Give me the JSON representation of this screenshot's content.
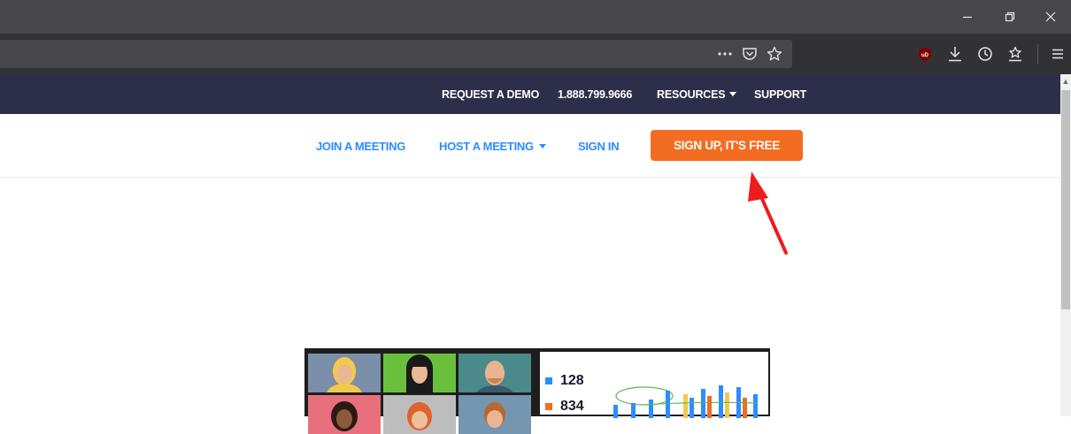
{
  "browser": {
    "window_controls": {
      "minimize": "minimize-icon",
      "restore": "restore-icon",
      "close": "close-icon"
    },
    "page_actions": [
      "more-icon",
      "pocket-icon",
      "bookmark-star-icon"
    ],
    "toolbar_icons": [
      "ublock-icon",
      "downloads-icon",
      "history-icon",
      "library-icon",
      "menu-icon"
    ],
    "ublock_label": "uD"
  },
  "site": {
    "topbar": {
      "items": [
        {
          "label": "REQUEST A DEMO"
        },
        {
          "label": "1.888.799.9666"
        },
        {
          "label": "RESOURCES"
        },
        {
          "label": "SUPPORT"
        }
      ]
    },
    "mainnav": {
      "join": "JOIN A MEETING",
      "host": "HOST A MEETING",
      "signin": "SIGN IN",
      "signup": "SIGN UP, IT'S FREE"
    },
    "hero": {
      "stats": [
        {
          "value": "128",
          "color": "#2d8cff"
        },
        {
          "value": "834",
          "color": "#f26d21"
        }
      ]
    }
  },
  "colors": {
    "brand_blue": "#2d8cff",
    "signup_orange": "#f26d21",
    "topbar_bg": "#2d2f4a",
    "annotation_arrow": "#ee1c1c"
  }
}
